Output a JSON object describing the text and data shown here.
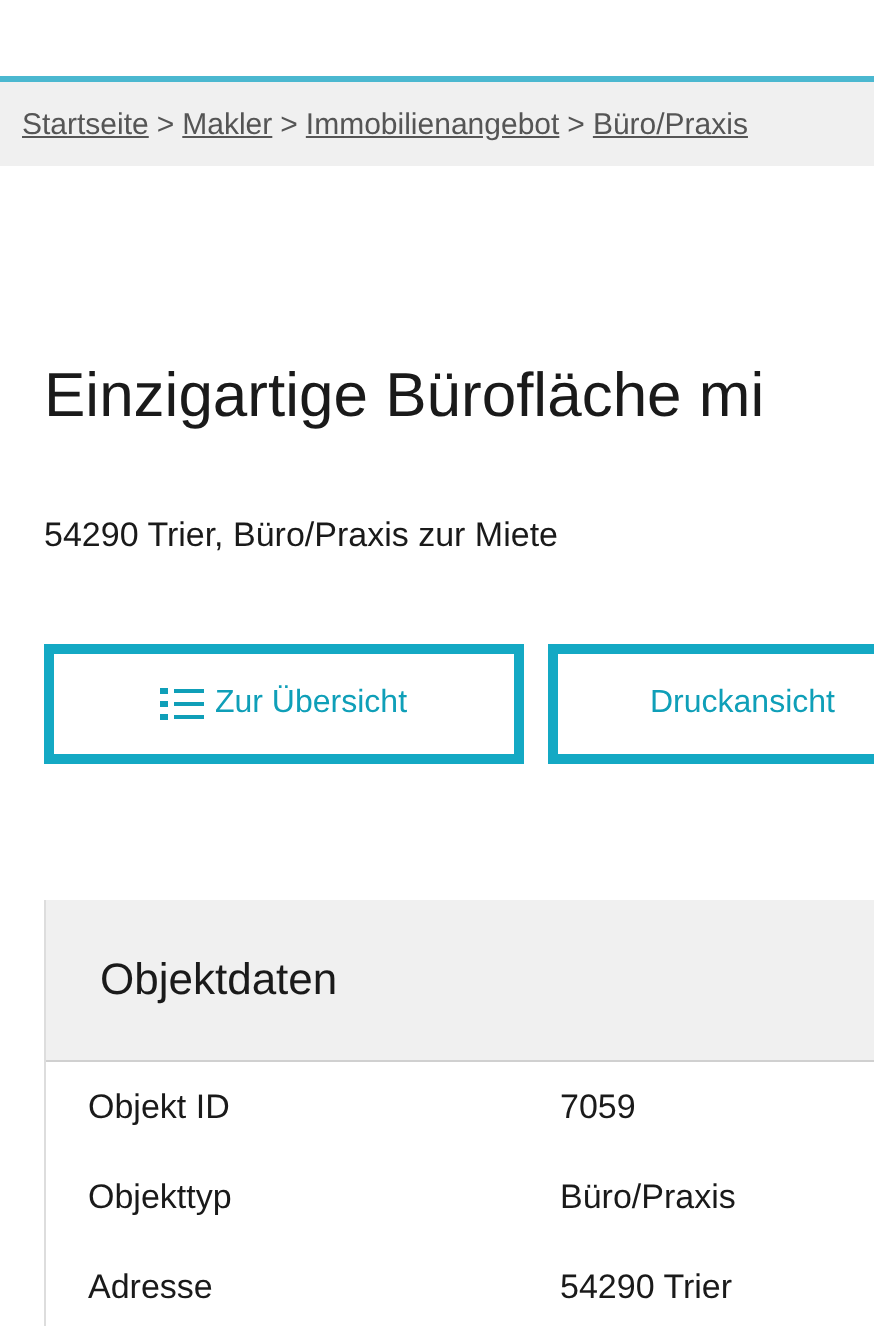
{
  "breadcrumb": [
    {
      "label": "Startseite"
    },
    {
      "label": "Makler"
    },
    {
      "label": "Immobilienangebot"
    },
    {
      "label": "Büro/Praxis"
    }
  ],
  "breadcrumb_separator": ">",
  "title": "Einzigartige Bürofläche mi",
  "subtitle": "54290 Trier, Büro/Praxis zur Miete",
  "buttons": [
    {
      "label": "Zur Übersicht",
      "kind": "icon"
    },
    {
      "label": "Druckansicht",
      "kind": "plain"
    }
  ],
  "table": {
    "title": "Objektdaten",
    "rows": [
      {
        "label": "Objekt ID",
        "value": "7059"
      },
      {
        "label": "Objekttyp",
        "value": "Büro/Praxis"
      },
      {
        "label": "Adresse",
        "value": "54290 Trier"
      }
    ]
  }
}
